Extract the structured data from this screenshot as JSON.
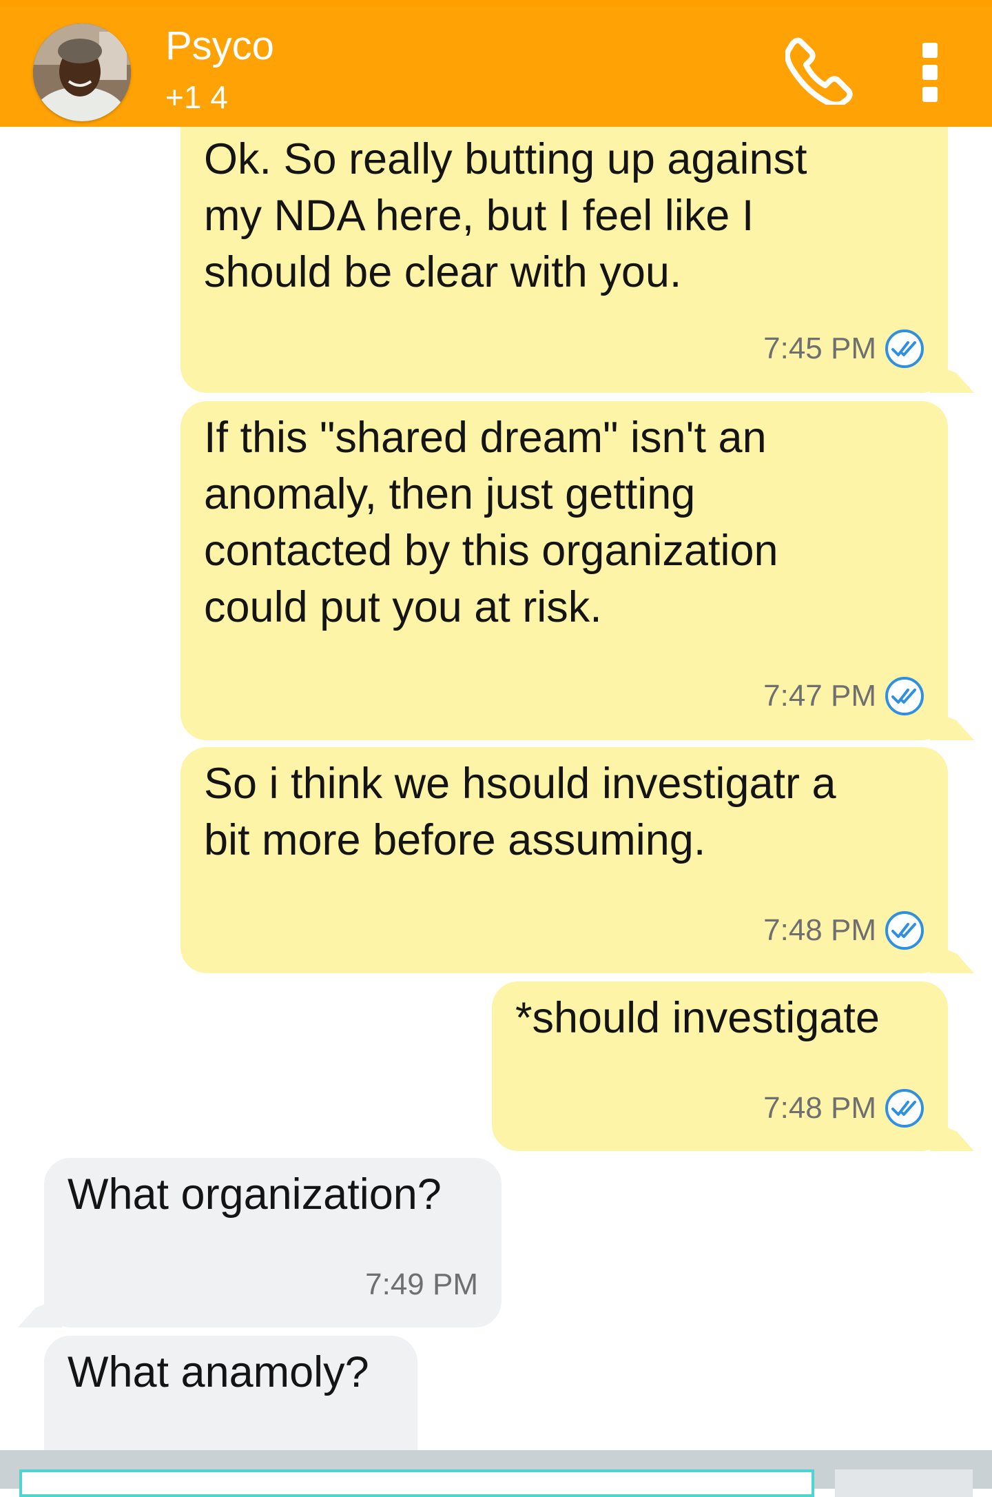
{
  "header": {
    "contact_name": "Psyco",
    "contact_number": "+1 4",
    "call_icon": "phone-icon",
    "menu_icon": "more-vertical-icon",
    "background_color": "#ffa205"
  },
  "messages": [
    {
      "direction": "outgoing",
      "text": "Ok. So really butting up against\nmy NDA here, but I feel like I\nshould be clear with you.",
      "time": "7:45 PM",
      "status_icon": "double-check-icon"
    },
    {
      "direction": "outgoing",
      "text": "If this \"shared dream\" isn't an\nanomaly, then just getting\ncontacted by this organization\ncould put you at risk.",
      "time": "7:47 PM",
      "status_icon": "double-check-icon"
    },
    {
      "direction": "outgoing",
      "text": "So i think we hsould investigatr a\nbit more before assuming.",
      "time": "7:48 PM",
      "status_icon": "double-check-icon"
    },
    {
      "direction": "outgoing",
      "text": "*should investigate",
      "time": "7:48 PM",
      "status_icon": "double-check-icon"
    },
    {
      "direction": "incoming",
      "text": "What organization?",
      "time": "7:49 PM"
    },
    {
      "direction": "incoming",
      "text": "What anamoly?",
      "time": ""
    }
  ],
  "compose": {
    "placeholder": "",
    "value": ""
  },
  "colors": {
    "outgoing_bubble": "#fdf4a8",
    "incoming_bubble": "#f0f1f3",
    "read_receipt": "#2f8fe0",
    "input_border": "#4fd5d0"
  }
}
